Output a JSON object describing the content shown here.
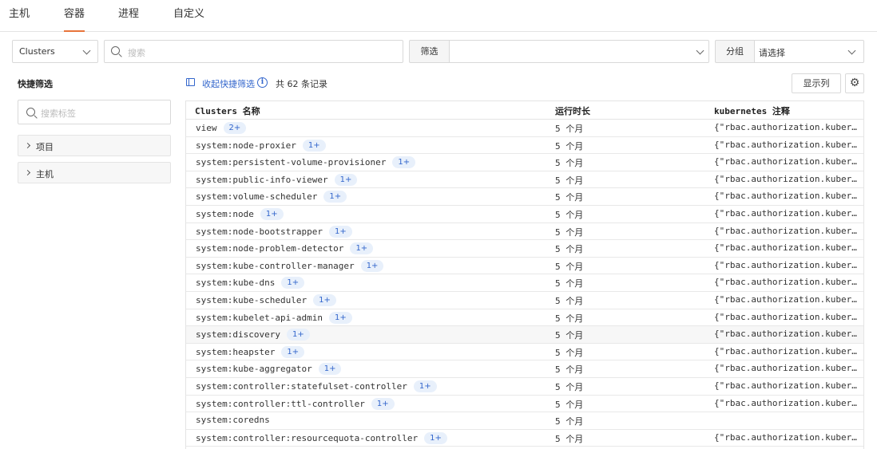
{
  "tabs": [
    {
      "label": "主机",
      "active": false
    },
    {
      "label": "容器",
      "active": true
    },
    {
      "label": "进程",
      "active": false
    },
    {
      "label": "自定义",
      "active": false
    }
  ],
  "toolbar": {
    "scope_select": "Clusters",
    "search_placeholder": "搜索",
    "filter_label": "筛选",
    "filter_value": "",
    "group_label": "分组",
    "group_placeholder": "请选择"
  },
  "quick_filter": {
    "title": "快捷筛选",
    "tag_search_placeholder": "搜索标签",
    "groups": [
      "项目",
      "主机"
    ]
  },
  "list_header": {
    "collapse_label": "收起快捷筛选",
    "record_count": "共 62 条记录",
    "columns_button": "显示列",
    "accent_color": "#3366cc"
  },
  "table": {
    "columns": [
      "Clusters 名称",
      "运行时长",
      "kubernetes 注释"
    ],
    "rows": [
      {
        "name": "view",
        "badge": "2+",
        "duration": "5 个月",
        "annotation": "{\"rbac.authorization.kubernetes.io/autoupdate\":\"true\"}"
      },
      {
        "name": "system:node-proxier",
        "badge": "1+",
        "duration": "5 个月",
        "annotation": "{\"rbac.authorization.kubernetes.io/autoupdate\":\"true\"}"
      },
      {
        "name": "system:persistent-volume-provisioner",
        "badge": "1+",
        "duration": "5 个月",
        "annotation": "{\"rbac.authorization.kubernetes.io/autoupdate\":\"true\"}"
      },
      {
        "name": "system:public-info-viewer",
        "badge": "1+",
        "duration": "5 个月",
        "annotation": "{\"rbac.authorization.kubernetes.io/autoupdate\":\"true\"}"
      },
      {
        "name": "system:volume-scheduler",
        "badge": "1+",
        "duration": "5 个月",
        "annotation": "{\"rbac.authorization.kubernetes.io/autoupdate\":\"true\"}"
      },
      {
        "name": "system:node",
        "badge": "1+",
        "duration": "5 个月",
        "annotation": "{\"rbac.authorization.kubernetes.io/autoupdate\":\"true\"}"
      },
      {
        "name": "system:node-bootstrapper",
        "badge": "1+",
        "duration": "5 个月",
        "annotation": "{\"rbac.authorization.kubernetes.io/autoupdate\":\"true\"}"
      },
      {
        "name": "system:node-problem-detector",
        "badge": "1+",
        "duration": "5 个月",
        "annotation": "{\"rbac.authorization.kubernetes.io/autoupdate\":\"true\"}"
      },
      {
        "name": "system:kube-controller-manager",
        "badge": "1+",
        "duration": "5 个月",
        "annotation": "{\"rbac.authorization.kubernetes.io/autoupdate\":\"true\"}"
      },
      {
        "name": "system:kube-dns",
        "badge": "1+",
        "duration": "5 个月",
        "annotation": "{\"rbac.authorization.kubernetes.io/autoupdate\":\"true\"}"
      },
      {
        "name": "system:kube-scheduler",
        "badge": "1+",
        "duration": "5 个月",
        "annotation": "{\"rbac.authorization.kubernetes.io/autoupdate\":\"true\"}"
      },
      {
        "name": "system:kubelet-api-admin",
        "badge": "1+",
        "duration": "5 个月",
        "annotation": "{\"rbac.authorization.kubernetes.io/autoupdate\":\"true\"}"
      },
      {
        "name": "system:discovery",
        "badge": "1+",
        "duration": "5 个月",
        "annotation": "{\"rbac.authorization.kubernetes.io/autoupdate\":\"true\"}",
        "highlight": true
      },
      {
        "name": "system:heapster",
        "badge": "1+",
        "duration": "5 个月",
        "annotation": "{\"rbac.authorization.kubernetes.io/autoupdate\":\"true\"}"
      },
      {
        "name": "system:kube-aggregator",
        "badge": "1+",
        "duration": "5 个月",
        "annotation": "{\"rbac.authorization.kubernetes.io/autoupdate\":\"true\"}"
      },
      {
        "name": "system:controller:statefulset-controller",
        "badge": "1+",
        "duration": "5 个月",
        "annotation": "{\"rbac.authorization.kubernetes.io/autoupdate\":\"true\"}"
      },
      {
        "name": "system:controller:ttl-controller",
        "badge": "1+",
        "duration": "5 个月",
        "annotation": "{\"rbac.authorization.kubernetes.io/autoupdate\":\"true\"}"
      },
      {
        "name": "system:coredns",
        "badge": "",
        "duration": "5 个月",
        "annotation": ""
      },
      {
        "name": "system:controller:resourcequota-controller",
        "badge": "1+",
        "duration": "5 个月",
        "annotation": "{\"rbac.authorization.kubernetes.io/autoupdate\":\"true\"}"
      }
    ]
  }
}
